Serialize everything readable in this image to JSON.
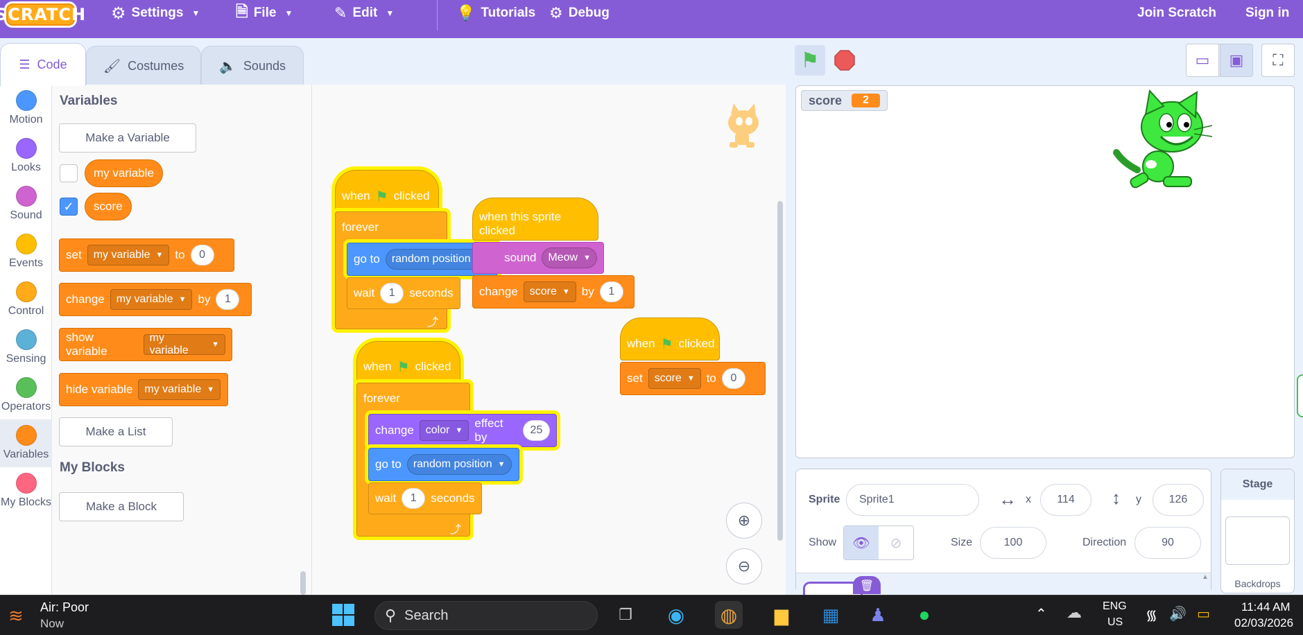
{
  "menubar": {
    "logo": "SCRATCH",
    "settings": "Settings",
    "file": "File",
    "edit": "Edit",
    "tutorials": "Tutorials",
    "debug": "Debug",
    "join": "Join Scratch",
    "signin": "Sign in"
  },
  "tabs": {
    "code": "Code",
    "costumes": "Costumes",
    "sounds": "Sounds"
  },
  "categories": [
    {
      "label": "Motion",
      "color": "#4c97ff"
    },
    {
      "label": "Looks",
      "color": "#9966ff"
    },
    {
      "label": "Sound",
      "color": "#cf63cf"
    },
    {
      "label": "Events",
      "color": "#ffbf00"
    },
    {
      "label": "Control",
      "color": "#ffab19"
    },
    {
      "label": "Sensing",
      "color": "#5cb1d6"
    },
    {
      "label": "Operators",
      "color": "#59c059"
    },
    {
      "label": "Variables",
      "color": "#ff8c1a"
    },
    {
      "label": "My Blocks",
      "color": "#ff6680"
    }
  ],
  "palette": {
    "heading_variables": "Variables",
    "make_variable": "Make a Variable",
    "var1": "my variable",
    "var2": "score",
    "set": "set",
    "set_var": "my variable",
    "to": "to",
    "set_value": "0",
    "change": "change",
    "change_var": "my variable",
    "by": "by",
    "change_value": "1",
    "show_variable": "show variable",
    "show_var": "my variable",
    "hide_variable": "hide variable",
    "hide_var": "my variable",
    "make_list": "Make a List",
    "heading_myblocks": "My Blocks",
    "make_block": "Make a Block"
  },
  "scripts": {
    "s1": {
      "when": "when",
      "clicked": "clicked",
      "forever": "forever",
      "goto": "go to",
      "goto_target": "random position",
      "wait": "wait",
      "wait_value": "1",
      "seconds": "seconds"
    },
    "s2": {
      "hat": "when this sprite clicked",
      "sound_suffix": "sound",
      "sound_name": "Meow",
      "change": "change",
      "var": "score",
      "by": "by",
      "value": "1"
    },
    "s3": {
      "when": "when",
      "clicked": "clicked",
      "forever": "forever",
      "change": "change",
      "effect": "color",
      "effect_by": "effect by",
      "effect_value": "25",
      "goto": "go to",
      "goto_target": "random position",
      "wait": "wait",
      "wait_value": "1",
      "seconds": "seconds"
    },
    "s4": {
      "when": "when",
      "clicked": "clicked",
      "set": "set",
      "var": "score",
      "to": "to",
      "value": "0"
    }
  },
  "stage": {
    "monitor_label": "score",
    "monitor_value": "2"
  },
  "sprite_info": {
    "sprite_label": "Sprite",
    "sprite_name": "Sprite1",
    "x_label": "x",
    "x_value": "114",
    "y_label": "y",
    "y_value": "126",
    "show_label": "Show",
    "size_label": "Size",
    "size_value": "100",
    "direction_label": "Direction",
    "direction_value": "90"
  },
  "stage_panel": {
    "title": "Stage",
    "backdrops": "Backdrops"
  },
  "taskbar": {
    "weather_title": "Air: Poor",
    "weather_sub": "Now",
    "search": "Search",
    "lang1": "ENG",
    "lang2": "US",
    "time": "11:44 AM",
    "date": "02/03/2026"
  }
}
